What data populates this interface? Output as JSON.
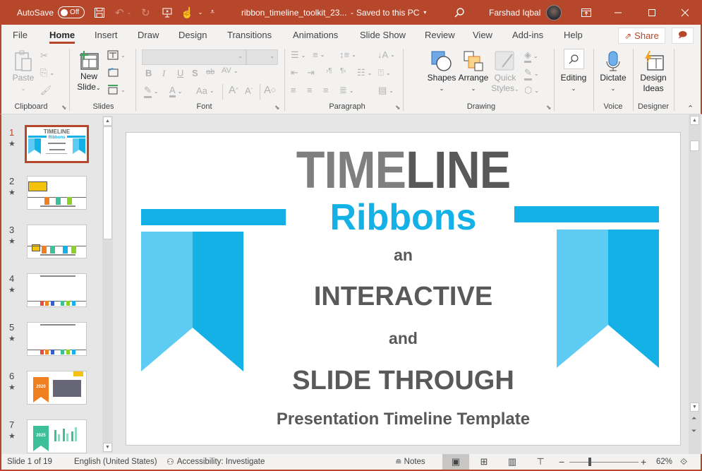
{
  "titlebar": {
    "autosave_label": "AutoSave",
    "autosave_state": "Off",
    "doc_title": "ribbon_timeline_toolkit_23...",
    "save_status": "Saved to this PC",
    "user_name": "Farshad Iqbal",
    "icons": [
      "save-icon",
      "undo-icon",
      "redo-icon",
      "present-icon",
      "touch-mode-icon",
      "customize-icon",
      "search-icon",
      "ribbon-display-icon",
      "minimize-icon",
      "maximize-icon",
      "close-icon"
    ]
  },
  "tabs": [
    {
      "label": "File"
    },
    {
      "label": "Home",
      "active": true
    },
    {
      "label": "Insert"
    },
    {
      "label": "Draw"
    },
    {
      "label": "Design"
    },
    {
      "label": "Transitions"
    },
    {
      "label": "Animations"
    },
    {
      "label": "Slide Show"
    },
    {
      "label": "Review"
    },
    {
      "label": "View"
    },
    {
      "label": "Add-ins"
    },
    {
      "label": "Help"
    }
  ],
  "share_label": "Share",
  "ribbon": {
    "clipboard": {
      "label": "Clipboard",
      "paste": "Paste"
    },
    "slides": {
      "label": "Slides",
      "new_slide_line1": "New",
      "new_slide_line2": "Slide"
    },
    "font": {
      "label": "Font",
      "font_name": "",
      "font_size": "",
      "bold": "B",
      "italic": "I",
      "underline": "U",
      "shadow": "S",
      "strike": "ab",
      "spacing": "AV",
      "case": "Aa",
      "grow": "A",
      "shrink": "A"
    },
    "paragraph": {
      "label": "Paragraph"
    },
    "drawing": {
      "label": "Drawing",
      "shapes": "Shapes",
      "arrange": "Arrange",
      "quick_styles_line1": "Quick",
      "quick_styles_line2": "Styles"
    },
    "editing": {
      "label": "Editing"
    },
    "voice": {
      "label": "Voice",
      "dictate": "Dictate"
    },
    "designer": {
      "label": "Designer",
      "design_ideas_line1": "Design",
      "design_ideas_line2": "Ideas"
    }
  },
  "thumbnails": [
    {
      "num": "1",
      "active": true,
      "kind": "title"
    },
    {
      "num": "2",
      "kind": "timeline"
    },
    {
      "num": "3",
      "kind": "timeline"
    },
    {
      "num": "4",
      "kind": "timeline-multi"
    },
    {
      "num": "5",
      "kind": "timeline-multi"
    },
    {
      "num": "6",
      "kind": "year",
      "year": "2020",
      "color": "#f07f22"
    },
    {
      "num": "7",
      "kind": "year",
      "year": "2025",
      "color": "#3dbf9a"
    }
  ],
  "slide": {
    "title_part1": "TIME",
    "title_part2": "LINE",
    "subtitle": "Ribbons",
    "line1": "an",
    "line2": "INTERACTIVE",
    "line3": "and",
    "line4": "SLIDE THROUGH",
    "line5": "Presentation Timeline Template",
    "colors": {
      "accent": "#14b1e7",
      "accent_light": "#5ecbf2",
      "title_light": "#7f7f7f",
      "title_dark": "#595959"
    }
  },
  "thumb1": {
    "title": "TIMELINE",
    "subtitle": "Ribbons"
  },
  "status": {
    "slide_pos": "Slide 1 of 19",
    "language": "English (United States)",
    "accessibility": "Accessibility: Investigate",
    "notes": "Notes",
    "zoom": "62%",
    "zoom_fraction": 0.3
  },
  "brand_color": "#b7472a"
}
